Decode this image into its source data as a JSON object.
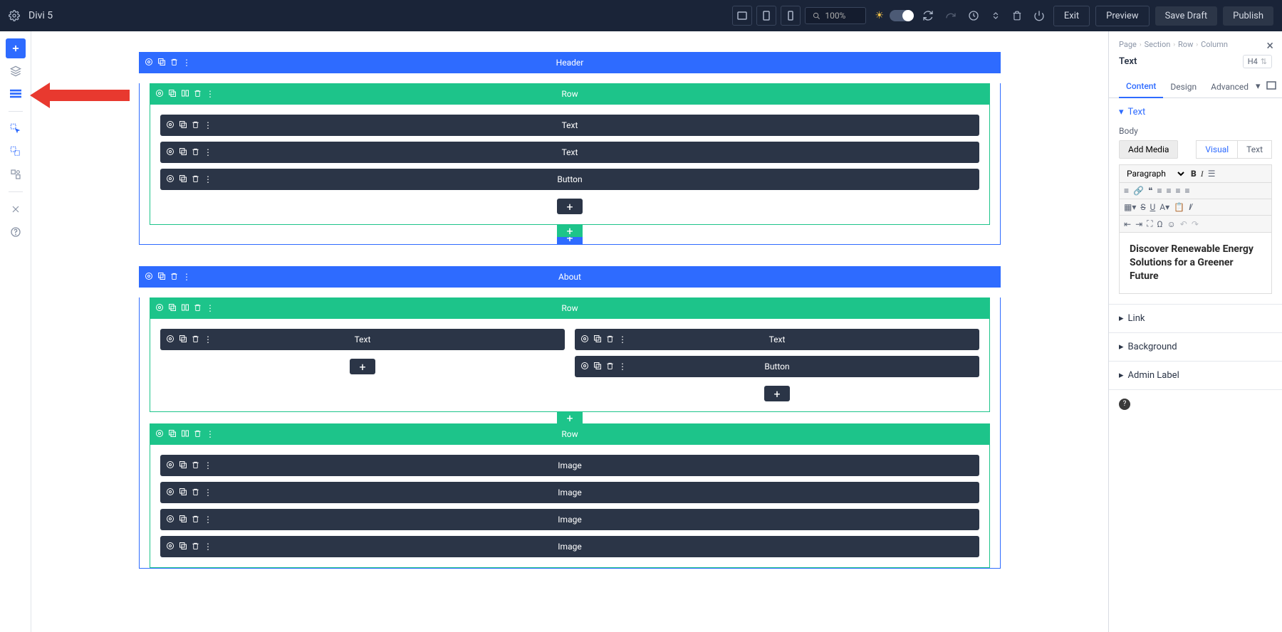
{
  "topbar": {
    "app_title": "Divi 5",
    "zoom_value": "100%",
    "exit": "Exit",
    "preview": "Preview",
    "save_draft": "Save Draft",
    "publish": "Publish"
  },
  "breadcrumb": {
    "page": "Page",
    "section": "Section",
    "row": "Row",
    "column": "Column"
  },
  "panel": {
    "title": "Text",
    "heading_badge": "H4",
    "tabs": {
      "content": "Content",
      "design": "Design",
      "advanced": "Advanced"
    },
    "acc_text": "Text",
    "body_label": "Body",
    "add_media": "Add Media",
    "editor_tabs": {
      "visual": "Visual",
      "text": "Text"
    },
    "paragraph_sel": "Paragraph",
    "editor_content": "Discover Renewable Energy Solutions for a Greener Future",
    "acc_link": "Link",
    "acc_background": "Background",
    "acc_admin_label": "Admin Label"
  },
  "canvas": {
    "sections": [
      {
        "title": "Header",
        "rows": [
          {
            "title": "Row",
            "columns": [
              {
                "modules": [
                  "Text",
                  "Text",
                  "Button"
                ],
                "show_add": true
              }
            ],
            "show_add_row_after": true,
            "show_add_sec_after": true
          }
        ]
      },
      {
        "title": "About",
        "rows": [
          {
            "title": "Row",
            "columns": [
              {
                "modules": [
                  "Text"
                ],
                "show_add": true
              },
              {
                "modules": [
                  "Text",
                  "Button"
                ],
                "show_add": true
              }
            ],
            "show_add_row_after": true
          },
          {
            "title": "Row",
            "columns": [
              {
                "modules": [
                  "Image",
                  "Image",
                  "Image",
                  "Image"
                ],
                "show_add": false
              }
            ]
          }
        ]
      }
    ]
  }
}
